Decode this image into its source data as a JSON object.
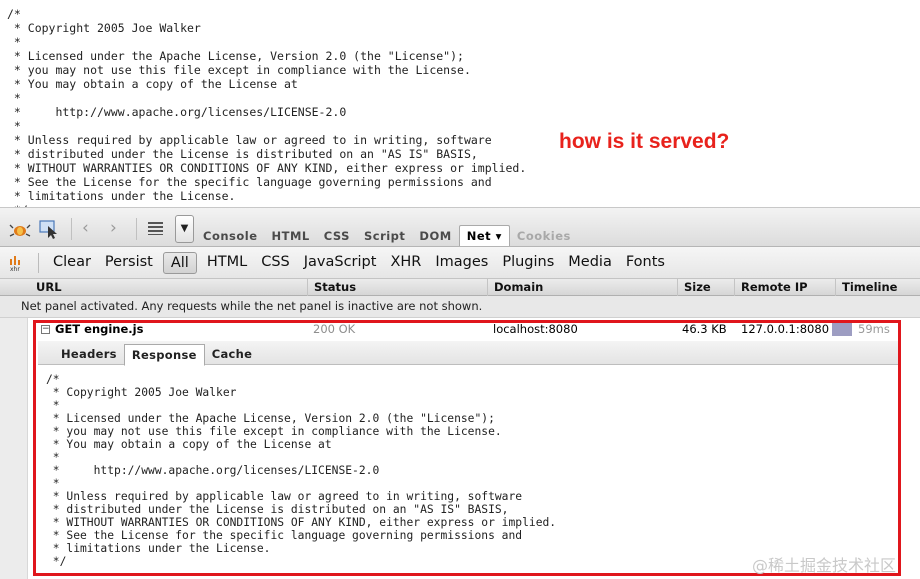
{
  "source": {
    "text": "/*\n * Copyright 2005 Joe Walker\n *\n * Licensed under the Apache License, Version 2.0 (the \"License\");\n * you may not use this file except in compliance with the License.\n * You may obtain a copy of the License at\n *\n *     http://www.apache.org/licenses/LICENSE-2.0\n *\n * Unless required by applicable law or agreed to in writing, software\n * distributed under the License is distributed on an \"AS IS\" BASIS,\n * WITHOUT WARRANTIES OR CONDITIONS OF ANY KIND, either express or implied.\n * See the License for the specific language governing permissions and\n * limitations under the License.\n */"
  },
  "annotation": "how is it served?",
  "toolbar": {
    "tabs": [
      {
        "label": "Console",
        "state": "normal"
      },
      {
        "label": "HTML",
        "state": "normal"
      },
      {
        "label": "CSS",
        "state": "normal"
      },
      {
        "label": "Script",
        "state": "normal"
      },
      {
        "label": "DOM",
        "state": "normal"
      },
      {
        "label": "Net ▾",
        "state": "active"
      },
      {
        "label": "Cookies",
        "state": "disabled"
      }
    ],
    "dropdown_glyph": "▼"
  },
  "filters": {
    "items": [
      "Clear",
      "Persist",
      "All",
      "HTML",
      "CSS",
      "JavaScript",
      "XHR",
      "Images",
      "Plugins",
      "Media",
      "Fonts"
    ],
    "active": "All"
  },
  "columns": {
    "url": "URL",
    "status": "Status",
    "domain": "Domain",
    "size": "Size",
    "remote_ip": "Remote IP",
    "timeline": "Timeline"
  },
  "info_message": "Net panel activated. Any requests while the net panel is inactive are not shown.",
  "request": {
    "expand_glyph": "−",
    "url": "GET engine.js",
    "status": "200 OK",
    "domain": "localhost:8080",
    "size": "46.3 KB",
    "remote_ip": "127.0.0.1:8080",
    "time": "59ms"
  },
  "response_tabs": [
    {
      "label": "Headers",
      "active": false
    },
    {
      "label": "Response",
      "active": true
    },
    {
      "label": "Cache",
      "active": false
    }
  ],
  "response_body": "/*\n * Copyright 2005 Joe Walker\n *\n * Licensed under the Apache License, Version 2.0 (the \"License\");\n * you may not use this file except in compliance with the License.\n * You may obtain a copy of the License at\n *\n *     http://www.apache.org/licenses/LICENSE-2.0\n *\n * Unless required by applicable law or agreed to in writing, software\n * distributed under the License is distributed on an \"AS IS\" BASIS,\n * WITHOUT WARRANTIES OR CONDITIONS OF ANY KIND, either express or implied.\n * See the License for the specific language governing permissions and\n * limitations under the License.\n */",
  "colors": {
    "annotation": "#e8221c",
    "highlight_box": "#e0161c",
    "timeline_bar": "#9d9dc2"
  },
  "watermark": "@稀土掘金技术社区"
}
